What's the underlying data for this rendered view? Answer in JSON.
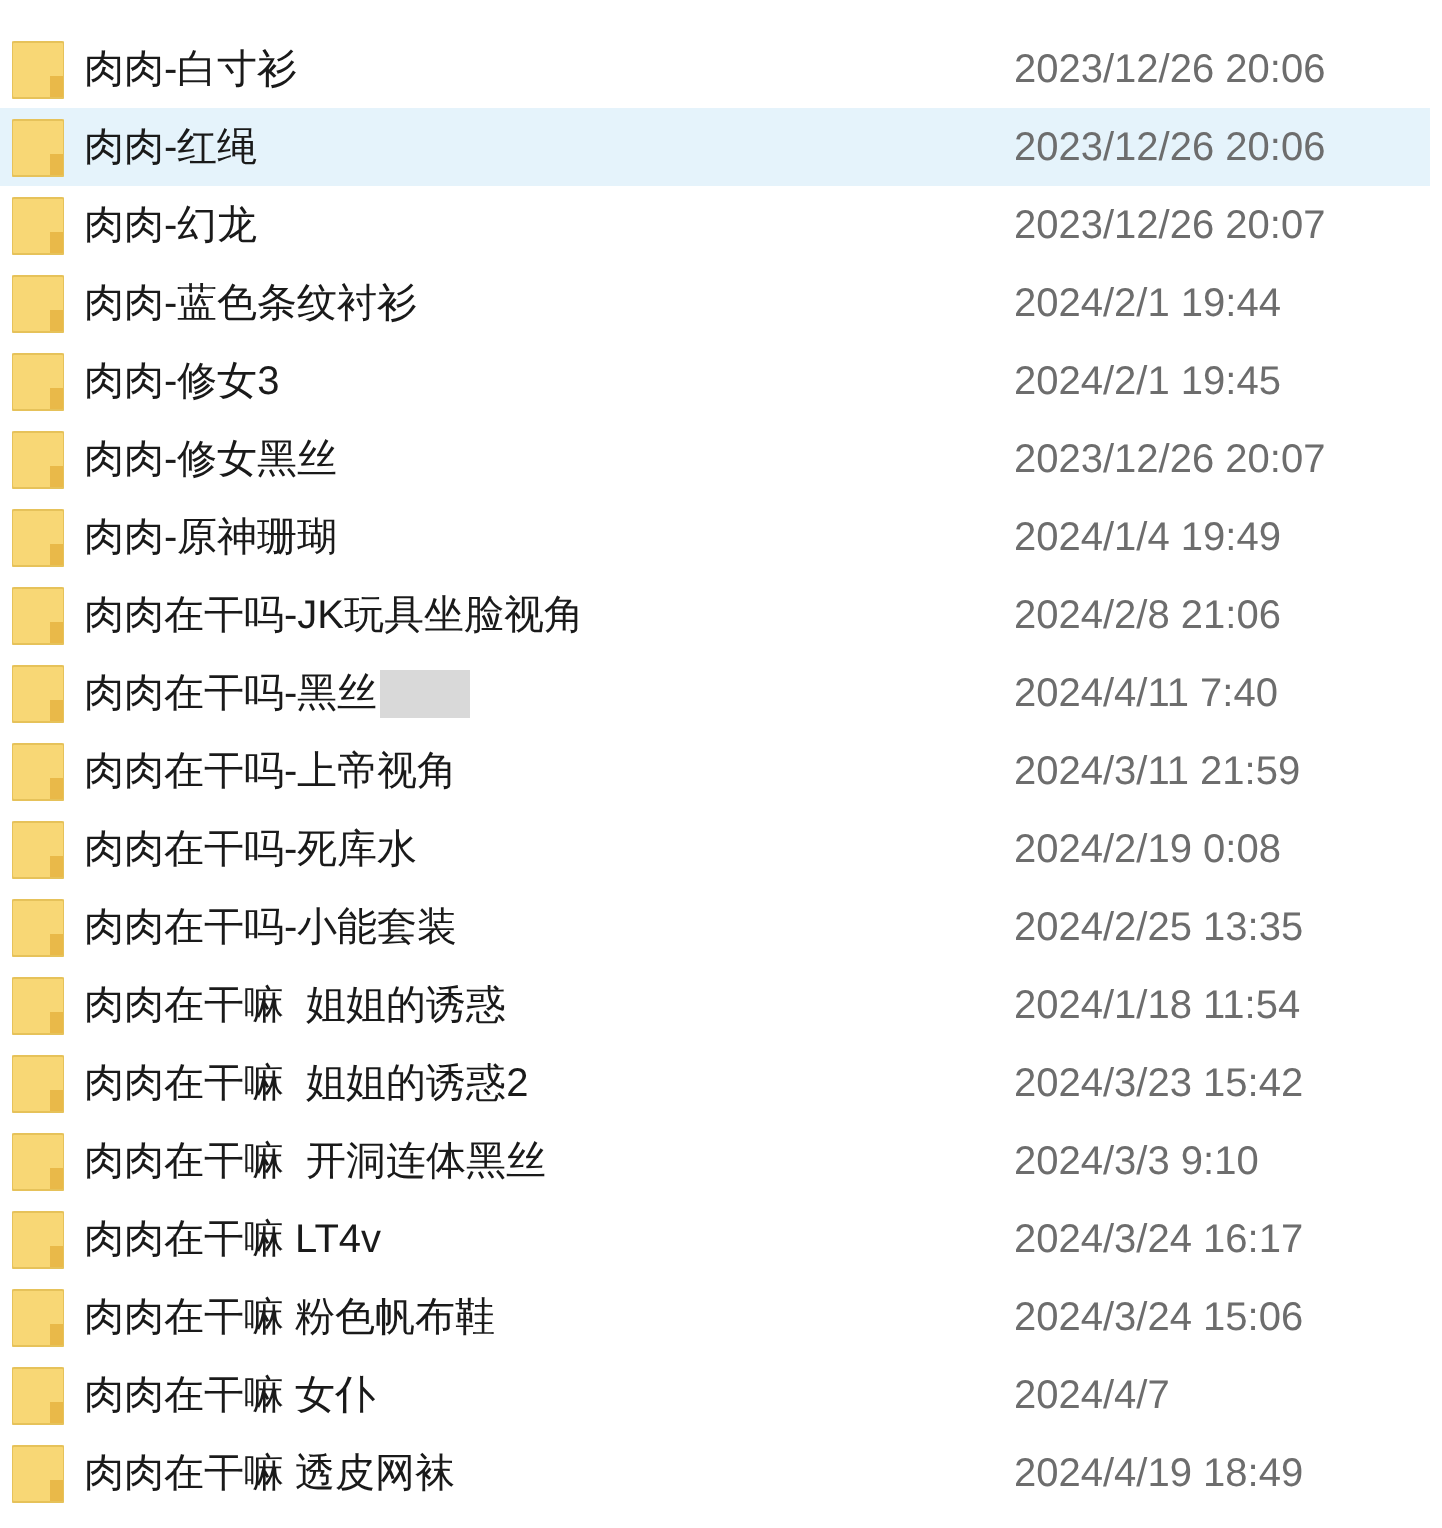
{
  "files": [
    {
      "name": "肉肉-白寸衫",
      "date": "2023/12/26 20:06",
      "selected": false
    },
    {
      "name": "肉肉-红绳",
      "date": "2023/12/26 20:06",
      "selected": true
    },
    {
      "name": "肉肉-幻龙",
      "date": "2023/12/26 20:07",
      "selected": false
    },
    {
      "name": "肉肉-蓝色条纹衬衫",
      "date": "2024/2/1 19:44",
      "selected": false
    },
    {
      "name": "肉肉-修女3",
      "date": "2024/2/1 19:45",
      "selected": false
    },
    {
      "name": "肉肉-修女黑丝",
      "date": "2023/12/26 20:07",
      "selected": false
    },
    {
      "name": "肉肉-原神珊瑚",
      "date": "2024/1/4 19:49",
      "selected": false
    },
    {
      "name": "肉肉在干吗-JK玩具坐脸视角",
      "date": "2024/2/8 21:06",
      "selected": false
    },
    {
      "name": "肉肉在干吗-黑丝",
      "date": "2024/4/11 7:40",
      "selected": false,
      "redacted": true
    },
    {
      "name": "肉肉在干吗-上帝视角",
      "date": "2024/3/11 21:59",
      "selected": false
    },
    {
      "name": "肉肉在干吗-死库水",
      "date": "2024/2/19 0:08",
      "selected": false
    },
    {
      "name": "肉肉在干吗-小能套装",
      "date": "2024/2/25 13:35",
      "selected": false
    },
    {
      "name": "肉肉在干嘛  姐姐的诱惑",
      "date": "2024/1/18 11:54",
      "selected": false
    },
    {
      "name": "肉肉在干嘛  姐姐的诱惑2",
      "date": "2024/3/23 15:42",
      "selected": false
    },
    {
      "name": "肉肉在干嘛  开洞连体黑丝",
      "date": "2024/3/3 9:10",
      "selected": false
    },
    {
      "name": "肉肉在干嘛 LT4v",
      "date": "2024/3/24 16:17",
      "selected": false
    },
    {
      "name": "肉肉在干嘛 粉色帆布鞋",
      "date": "2024/3/24 15:06",
      "selected": false
    },
    {
      "name": "肉肉在干嘛 女仆",
      "date": "2024/4/7",
      "selected": false
    },
    {
      "name": "肉肉在干嘛 透皮网袜",
      "date": "2024/4/19 18:49",
      "selected": false
    }
  ]
}
